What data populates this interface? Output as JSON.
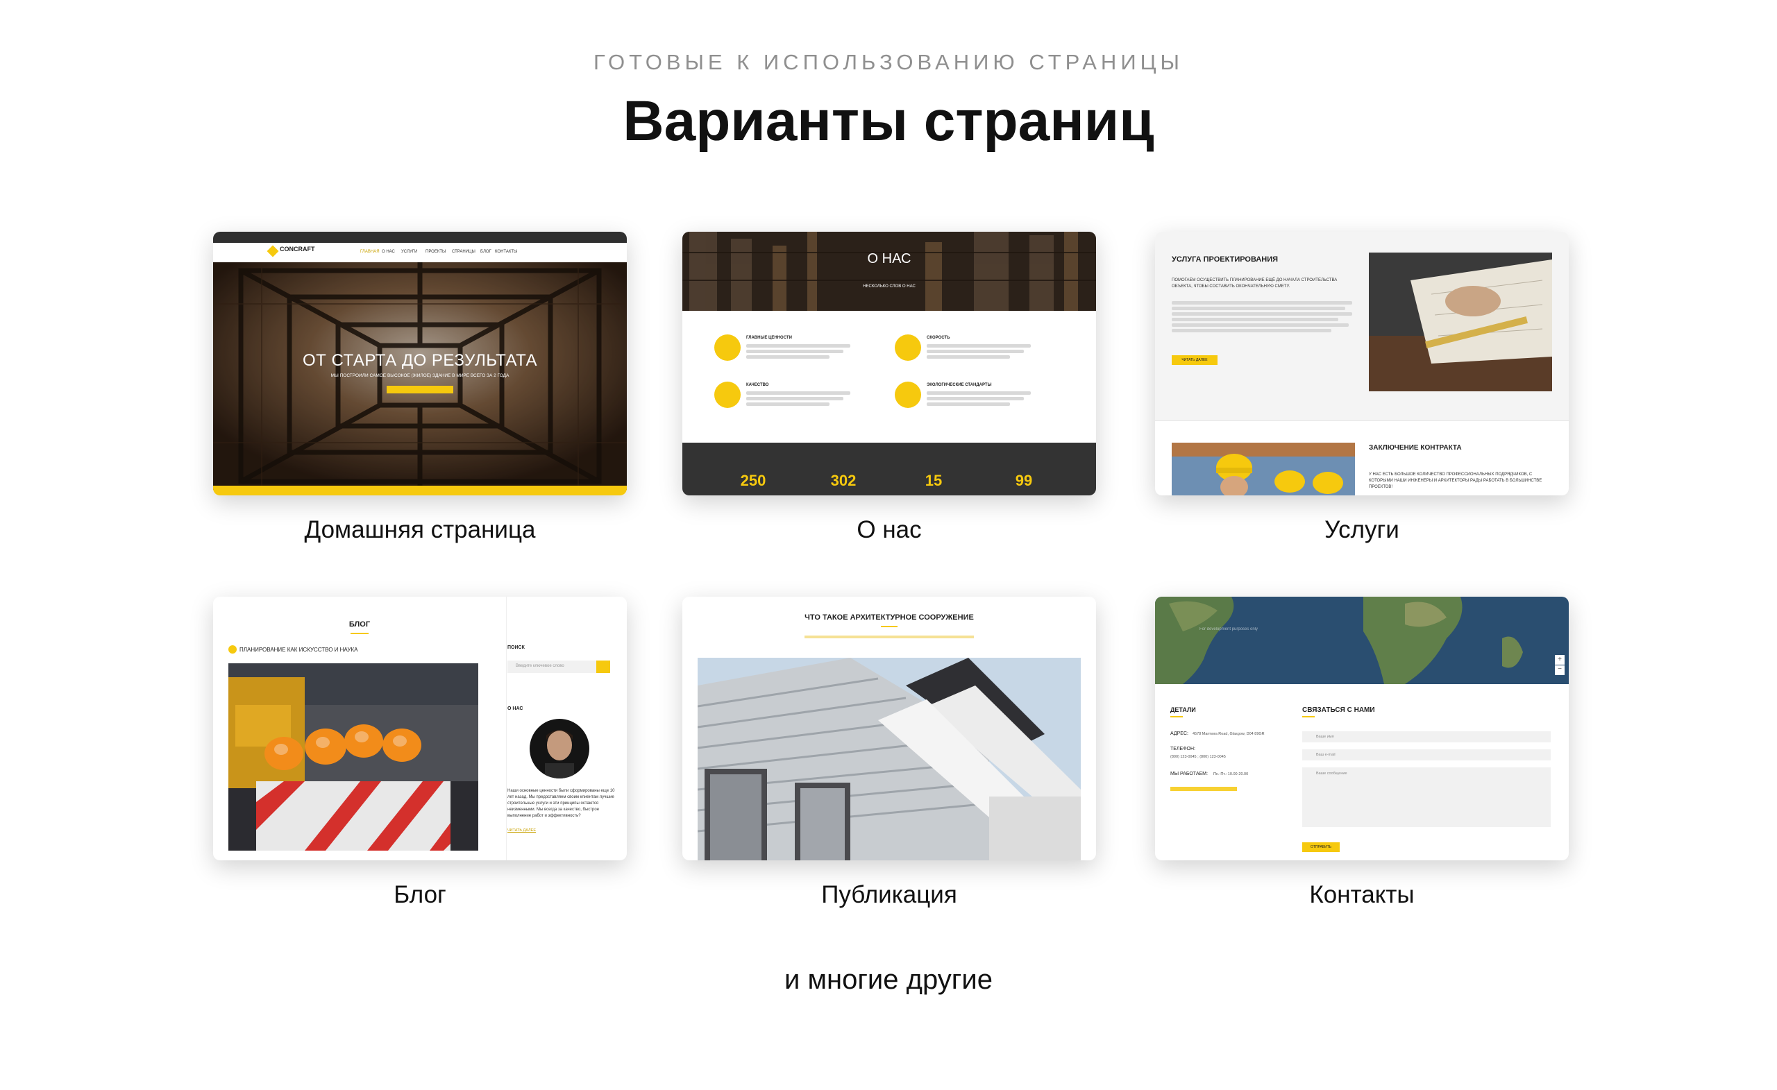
{
  "header": {
    "eyebrow": "ГОТОВЫЕ К ИСПОЛЬЗОВАНИЮ СТРАНИЦЫ",
    "title": "Варианты страниц"
  },
  "colors": {
    "accent": "#f6c90e",
    "dark": "#333333",
    "text": "#111111",
    "muted": "#8f8f8f"
  },
  "cards": [
    {
      "caption": "Домашняя страница",
      "logo": "CONCRAFT",
      "nav": [
        "ГЛАВНАЯ",
        "О НАС",
        "УСЛУГИ",
        "ПРОЕКТЫ",
        "СТРАНИЦЫ",
        "БЛОГ",
        "КОНТАКТЫ"
      ],
      "hero_title": "ОТ СТАРТА ДО РЕЗУЛЬТАТА",
      "hero_subtitle": "МЫ ПОСТРОИЛИ САМОЕ ВЫСОКОЕ (ЖИЛОЕ) ЗДАНИЕ В МИРЕ ВСЕГО ЗА 2 ГОДА"
    },
    {
      "caption": "О нас",
      "hero_title": "О НАС",
      "hero_subtitle": "НЕСКОЛЬКО СЛОВ О НАС",
      "features": [
        "ГЛАВНЫЕ ЦЕННОСТИ",
        "СКОРОСТЬ",
        "КАЧЕСТВО",
        "ЭКОЛОГИЧЕСКИЕ СТАНДАРТЫ"
      ],
      "counters": [
        "250",
        "302",
        "15",
        "99"
      ]
    },
    {
      "caption": "Услуги",
      "service_1": "УСЛУГА ПРОЕКТИРОВАНИЯ",
      "service_1_lead": "ПОМОГАЕМ ОСУЩЕСТВИТЬ ПЛАНИРОВАНИЕ ЕЩЁ ДО НАЧАЛА СТРОИТЕЛЬСТВА ОБЪЕКТА, ЧТОБЫ СОСТАВИТЬ ОКОНЧАТЕЛЬНУЮ СМЕТУ.",
      "button": "ЧИТАТЬ ДАЛЕЕ",
      "service_2": "ЗАКЛЮЧЕНИЕ КОНТРАКТА",
      "service_2_lead": "У НАС ЕСТЬ БОЛЬШОЕ КОЛИЧЕСТВО ПРОФЕССИОНАЛЬНЫХ ПОДРЯДЧИКОВ, С КОТОРЫМИ НАШИ ИНЖЕНЕРЫ И АРХИТЕКТОРЫ РАДЫ РАБОТАТЬ В БОЛЬШИНСТВЕ ПРОЕКТОВ!"
    },
    {
      "caption": "Блог",
      "title": "БЛОГ",
      "post_title": "ПЛАНИРОВАНИЕ КАК ИСКУССТВО И НАУКА",
      "search_label": "ПОИСК",
      "search_placeholder": "Введите ключевое слово",
      "about_label": "О НАС",
      "about_text": "Наши основные ценности были сформированы еще 10 лет назад. Мы предоставляем своим клиентам лучшие строительные услуги и эти принципы остаются неизменными. Мы всегда за качество, быстрое выполнение работ и эффективность?",
      "read_more": "ЧИТАТЬ ДАЛЕЕ"
    },
    {
      "caption": "Публикация",
      "title": "ЧТО ТАКОЕ АРХИТЕКТУРНОЕ СООРУЖЕНИЕ"
    },
    {
      "caption": "Контакты",
      "map_label": "For development purposes only",
      "details_title": "ДЕТАЛИ",
      "address_label": "АДРЕС:",
      "address_value": "4578 Marmora Road, Glasgow, D04 89GR",
      "phone_label": "ТЕЛЕФОН:",
      "phone_value": "(800) 123-0045 ; (800) 123-0045",
      "hours_label": "МЫ РАБОТАЕМ:",
      "hours_value": "Пн.-Пт.: 10.00-20.00",
      "form_title": "СВЯЗАТЬСЯ С НАМИ",
      "name_placeholder": "Ваше имя",
      "email_placeholder": "Ваш e-mail",
      "message_placeholder": "Ваше сообщение",
      "send_button": "ОТПРАВИТЬ"
    }
  ],
  "footer_text": "и многие другие"
}
